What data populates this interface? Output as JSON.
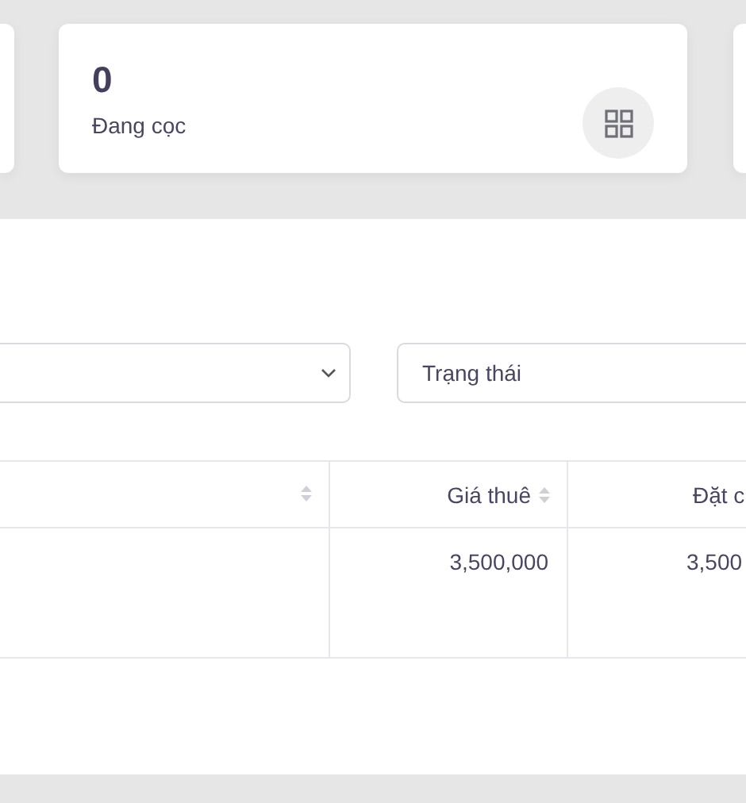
{
  "stat_card": {
    "value": "0",
    "label": "Đang cọc"
  },
  "filters": [
    {
      "kind": "select"
    },
    {
      "kind": "input",
      "placeholder": "Trạng thái"
    }
  ],
  "table": {
    "columns": [
      {
        "sortable": true
      },
      {
        "label": "Giá thuê",
        "sortable": true
      },
      {
        "label": "Đặt c",
        "sortable": false
      }
    ],
    "rows": [
      {
        "column_2": "3,500,000",
        "column_3": "3,500"
      }
    ]
  }
}
